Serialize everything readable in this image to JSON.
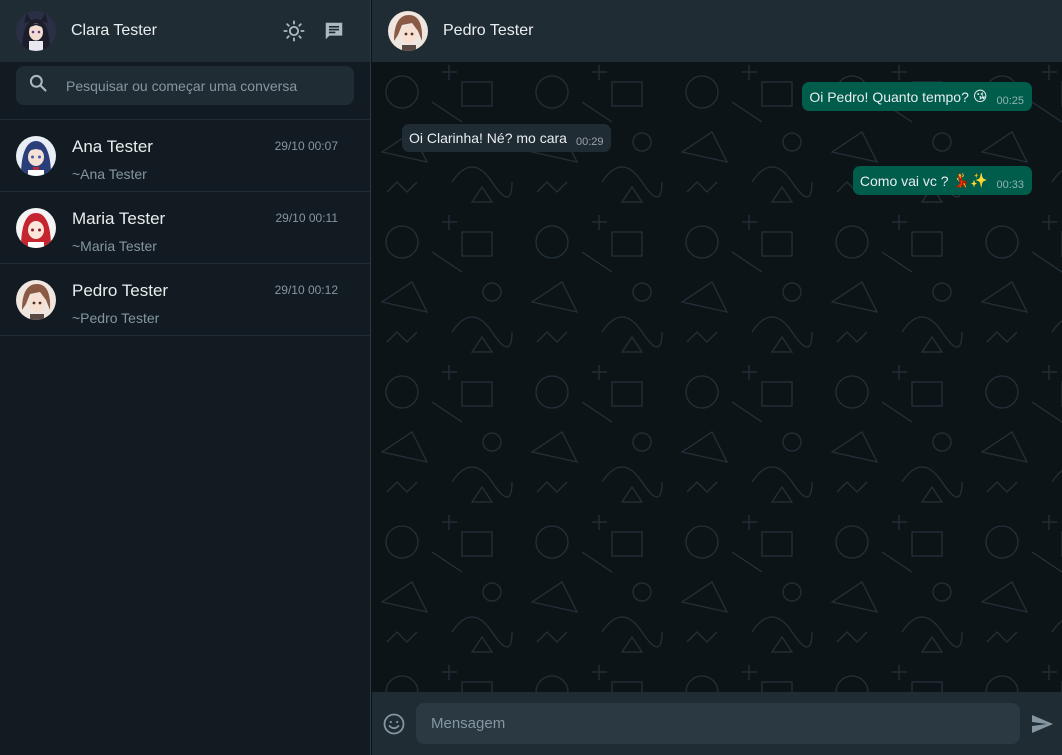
{
  "sidebar": {
    "user_name": "Clara Tester",
    "search": {
      "placeholder": "Pesquisar ou começar uma conversa",
      "value": ""
    },
    "icons": {
      "theme": "sun-icon",
      "new_chat": "message-icon",
      "search": "search-icon"
    },
    "chats": [
      {
        "name": "Ana Tester",
        "subtitle": "~Ana Tester",
        "time": "29/10 00:07"
      },
      {
        "name": "Maria Tester",
        "subtitle": "~Maria Tester",
        "time": "29/10 00:11"
      },
      {
        "name": "Pedro Tester",
        "subtitle": "~Pedro Tester",
        "time": "29/10 00:12"
      }
    ]
  },
  "conversation": {
    "contact_name": "Pedro Tester",
    "messages": [
      {
        "direction": "out",
        "text": "Oi Pedro! Quanto tempo?",
        "emoji": "😘",
        "time": "00:25"
      },
      {
        "direction": "in",
        "text": "Oi Clarinha! Né? mo cara",
        "time": "00:29"
      },
      {
        "direction": "out",
        "text": "Como vai vc ?",
        "emoji": "💃✨",
        "time": "00:33"
      }
    ],
    "composer": {
      "placeholder": "Mensagem",
      "value": ""
    },
    "icons": {
      "emoji": "emoji-icon",
      "send": "send-icon"
    }
  },
  "colors": {
    "panel": "#202c33",
    "sidebar_bg": "#111b21",
    "outgoing_bubble": "#005c4b",
    "incoming_bubble": "#202c33",
    "muted_text": "#8696a0"
  }
}
